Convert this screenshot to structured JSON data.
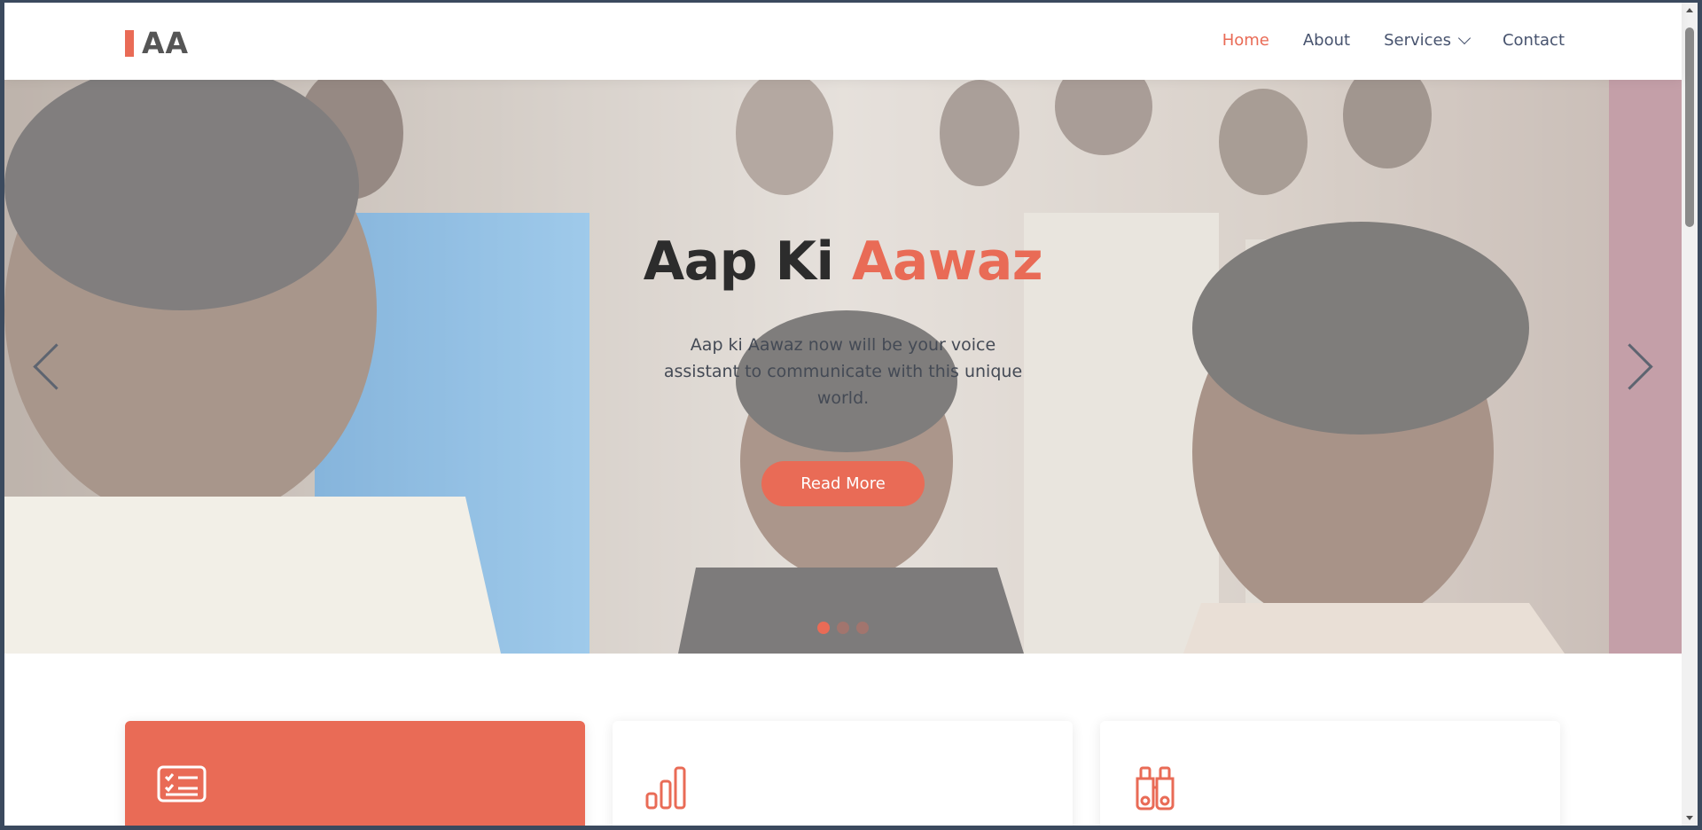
{
  "brand": {
    "logo_text": "AA",
    "accent_color": "#e96b56"
  },
  "nav": {
    "items": [
      {
        "label": "Home",
        "active": true
      },
      {
        "label": "About",
        "active": false
      },
      {
        "label": "Services",
        "active": false,
        "has_dropdown": true
      },
      {
        "label": "Contact",
        "active": false
      }
    ]
  },
  "hero": {
    "title_main": "Aap Ki ",
    "title_accent": "Aawaz",
    "description": "Aap ki Aawaz now will be your voice assistant to communicate with this unique world.",
    "button_label": "Read More",
    "slides": 3,
    "active_slide": 1
  },
  "features": {
    "cards": [
      {
        "icon": "checklist-icon",
        "active": true
      },
      {
        "icon": "bar-chart-icon",
        "active": false
      },
      {
        "icon": "binoculars-icon",
        "active": false
      }
    ]
  }
}
